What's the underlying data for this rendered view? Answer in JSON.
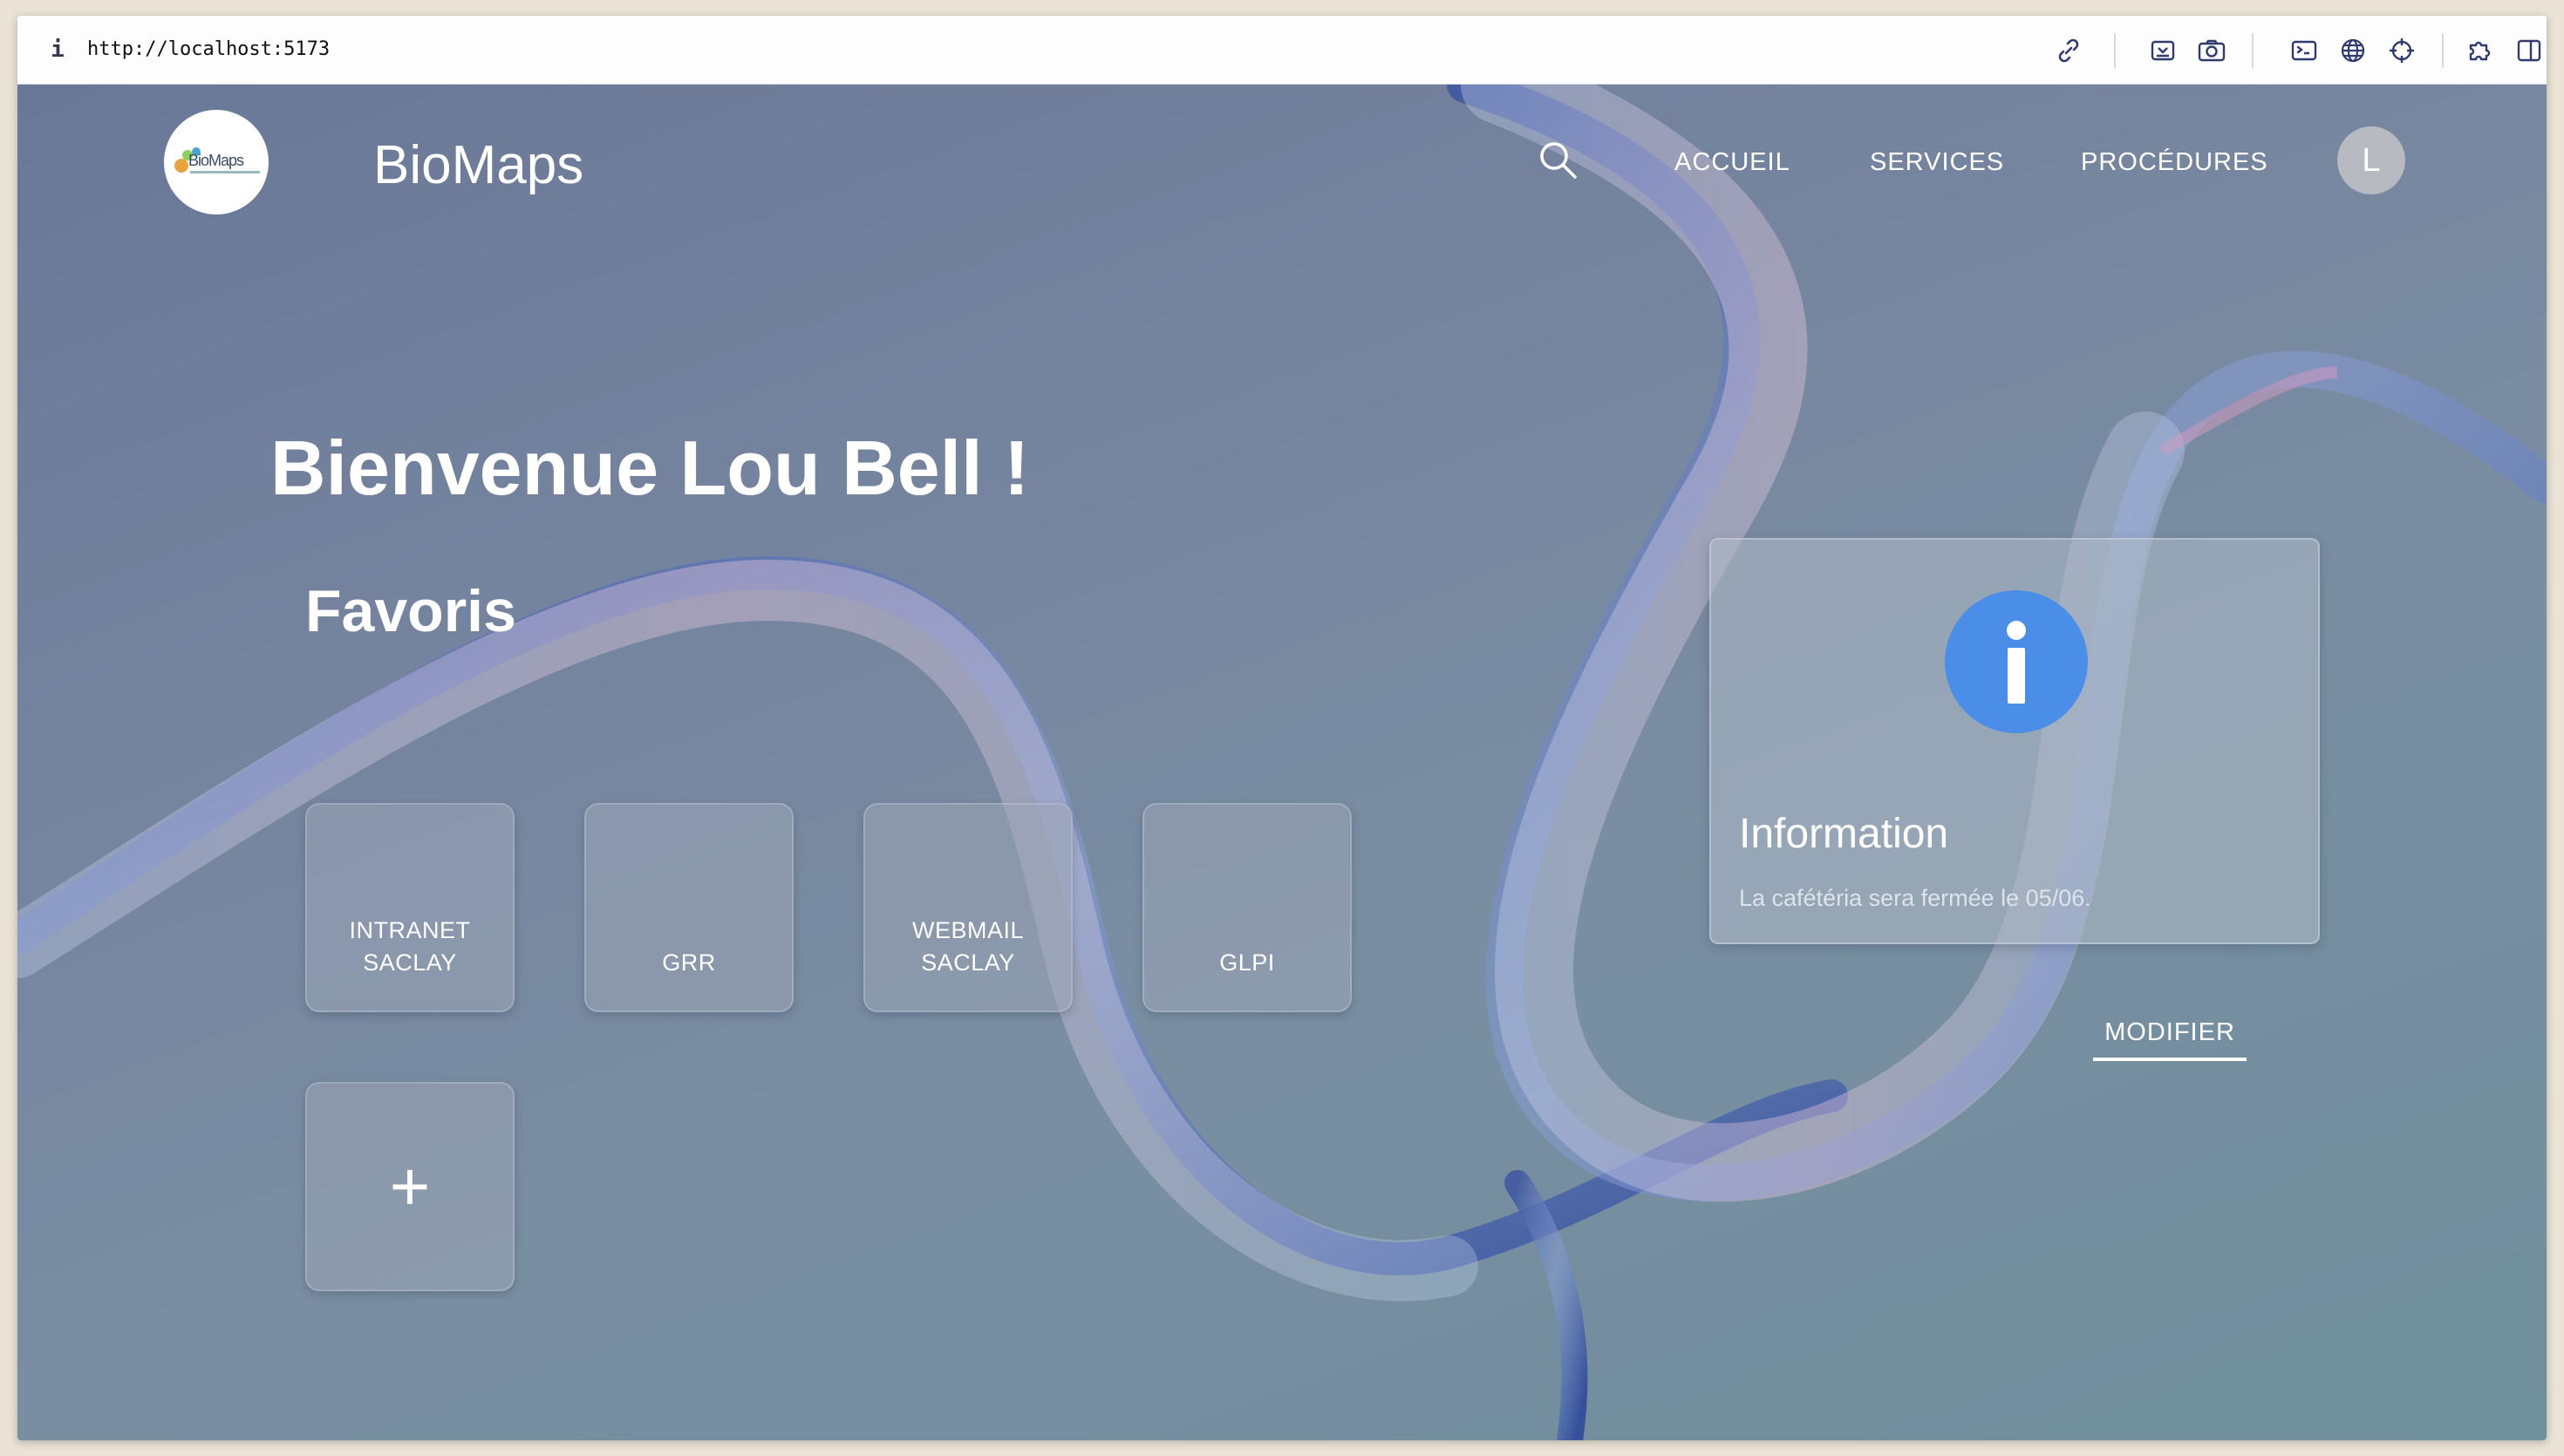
{
  "browser": {
    "info_glyph": "i",
    "url": "http://localhost:5173",
    "tools": [
      "link-icon",
      "screenshot-area-icon",
      "camera-icon",
      "terminal-icon",
      "globe-icon",
      "crosshair-icon",
      "extension-icon",
      "sidebar-icon"
    ]
  },
  "header": {
    "logo_text": "BioMaps",
    "brand": "BioMaps",
    "nav": [
      "ACCUEIL",
      "SERVICES",
      "PROCÉDURES"
    ],
    "avatar_initial": "L"
  },
  "main": {
    "welcome": "Bienvenue Lou Bell !",
    "favorites_title": "Favoris",
    "favorites": [
      {
        "label": "INTRANET SACLAY"
      },
      {
        "label": "GRR"
      },
      {
        "label": "WEBMAIL SACLAY"
      },
      {
        "label": "GLPI"
      }
    ],
    "add_label": "+"
  },
  "info": {
    "title": "Information",
    "text": "La cafétéria sera fermée le 05/06.",
    "icon": "info-icon",
    "icon_color": "#4a8ee8",
    "modify_label": "MODIFIER"
  }
}
